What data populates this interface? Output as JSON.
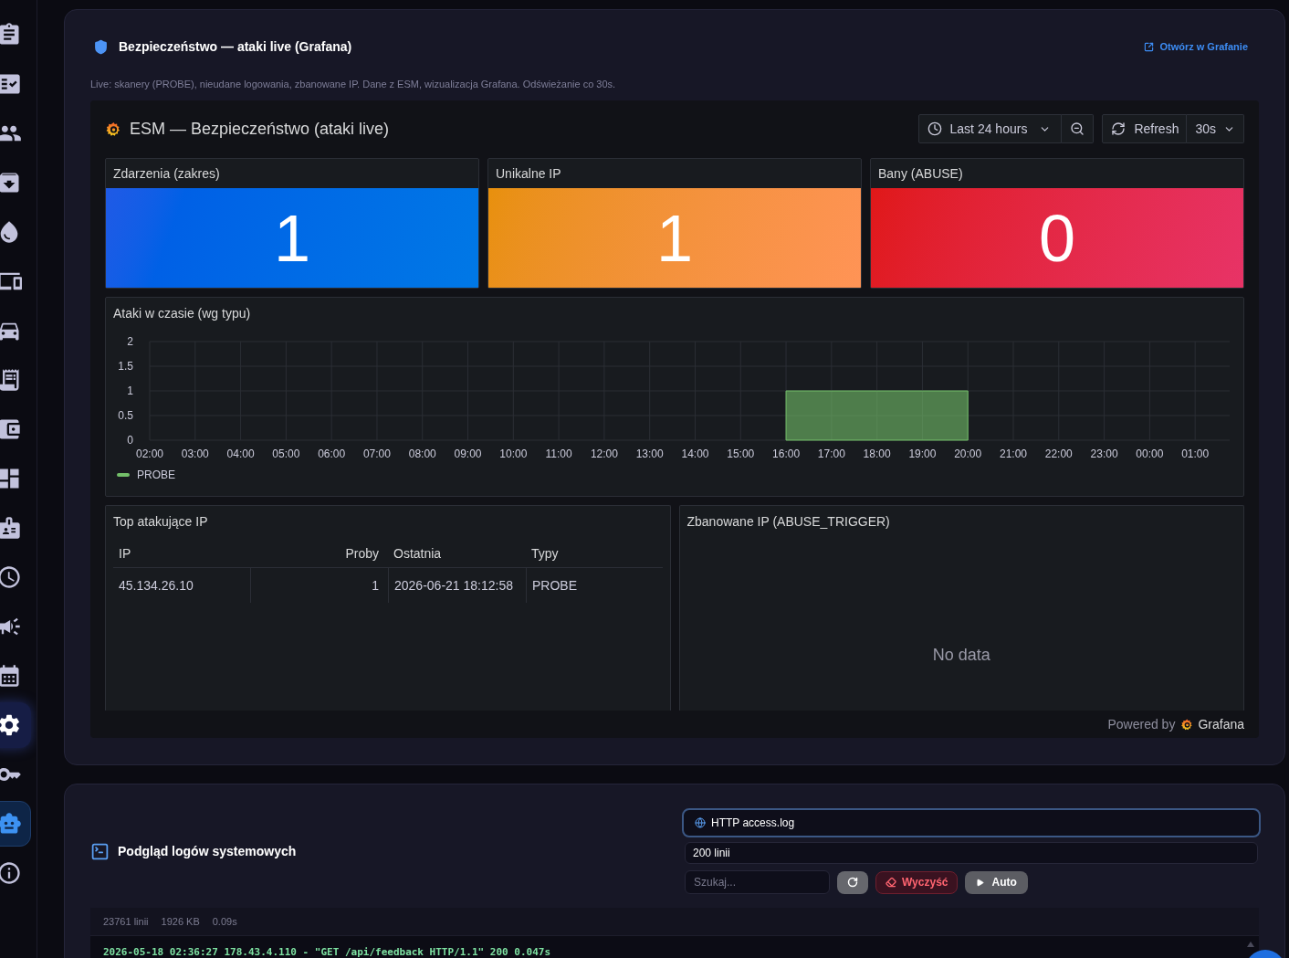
{
  "sidebar": {
    "items": [
      {
        "selected": false,
        "hovered": false
      },
      {
        "selected": false,
        "hovered": false
      },
      {
        "selected": false,
        "hovered": false
      },
      {
        "selected": false,
        "hovered": false
      },
      {
        "selected": false,
        "hovered": false
      },
      {
        "selected": false,
        "hovered": false
      },
      {
        "selected": false,
        "hovered": false
      },
      {
        "selected": false,
        "hovered": false
      },
      {
        "selected": false,
        "hovered": false
      },
      {
        "selected": false,
        "hovered": false
      },
      {
        "selected": false,
        "hovered": false
      },
      {
        "selected": false,
        "hovered": false
      },
      {
        "selected": false,
        "hovered": false
      },
      {
        "selected": false,
        "hovered": false
      },
      {
        "selected": false,
        "hovered": true
      },
      {
        "selected": false,
        "hovered": false
      },
      {
        "selected": true,
        "hovered": false
      },
      {
        "selected": false,
        "hovered": false
      }
    ]
  },
  "security_card": {
    "title": "Bezpieczeństwo — ataki live (Grafana)",
    "open_link": "Otwórz w Grafanie",
    "description": "Live: skanery (PROBE), nieudane logowania, zbanowane IP. Dane z ESM, wizualizacja Grafana. Odświeżanie co 30s.",
    "dashboard": {
      "title": "ESM — Bezpieczeństwo (ataki live)",
      "time_range": "Last 24 hours",
      "refresh": {
        "label": "Refresh",
        "interval": "30s"
      },
      "stat_panels": [
        {
          "title": "Zdarzenia (zakres)",
          "value": "1",
          "color": "#1f5ae6"
        },
        {
          "title": "Unikalne IP",
          "value": "1",
          "color": "#e8900c"
        },
        {
          "title": "Bany (ABUSE)",
          "value": "0",
          "color": "#e01818"
        }
      ],
      "timeseries_panel": {
        "chart_data": {
          "type": "area",
          "title": "Ataki w czasie (wg typu)",
          "grid": true,
          "categories": [
            "02:00",
            "03:00",
            "04:00",
            "05:00",
            "06:00",
            "07:00",
            "08:00",
            "09:00",
            "10:00",
            "11:00",
            "12:00",
            "13:00",
            "14:00",
            "15:00",
            "16:00",
            "17:00",
            "18:00",
            "19:00",
            "20:00",
            "21:00",
            "22:00",
            "23:00",
            "00:00",
            "01:00"
          ],
          "ylim": [
            0,
            2
          ],
          "yticks": [
            0,
            0.5,
            1,
            1.5,
            2
          ],
          "series": [
            {
              "name": "PROBE",
              "color": "#73bf69",
              "values": [
                null,
                null,
                null,
                null,
                null,
                null,
                null,
                null,
                null,
                null,
                null,
                null,
                null,
                null,
                1,
                1,
                1,
                1,
                1,
                null,
                null,
                null,
                null,
                null
              ]
            }
          ]
        }
      },
      "top_ip_panel": {
        "title": "Top atakujące IP",
        "columns": [
          "IP",
          "Proby",
          "Ostatnia",
          "Typy"
        ],
        "rows": [
          [
            "45.134.26.10",
            "1",
            "2026-06-21 18:12:58",
            "PROBE"
          ]
        ]
      },
      "banned_panel": {
        "title": "Zbanowane IP (ABUSE_TRIGGER)",
        "empty_message": "No data"
      },
      "footer": {
        "prefix": "Powered by",
        "brand": "Grafana"
      }
    }
  },
  "logs_card": {
    "title": "Podgląd logów systemowych",
    "source_select": {
      "value": "HTTP access.log",
      "focused": true
    },
    "lines_select": {
      "value": "200 linii"
    },
    "search": {
      "placeholder": "Szukaj..."
    },
    "buttons": [
      {
        "kind": "refresh"
      },
      {
        "kind": "clear",
        "label": "Wyczyść"
      },
      {
        "kind": "auto",
        "label": "Auto"
      }
    ],
    "stats": [
      "23761 linii",
      "1926 KB",
      "0.09s"
    ],
    "lines": [
      "2026-05-18 02:36:27 178.43.4.110 - \"GET /api/feedback HTTP/1.1\" 200 0.047s"
    ]
  }
}
